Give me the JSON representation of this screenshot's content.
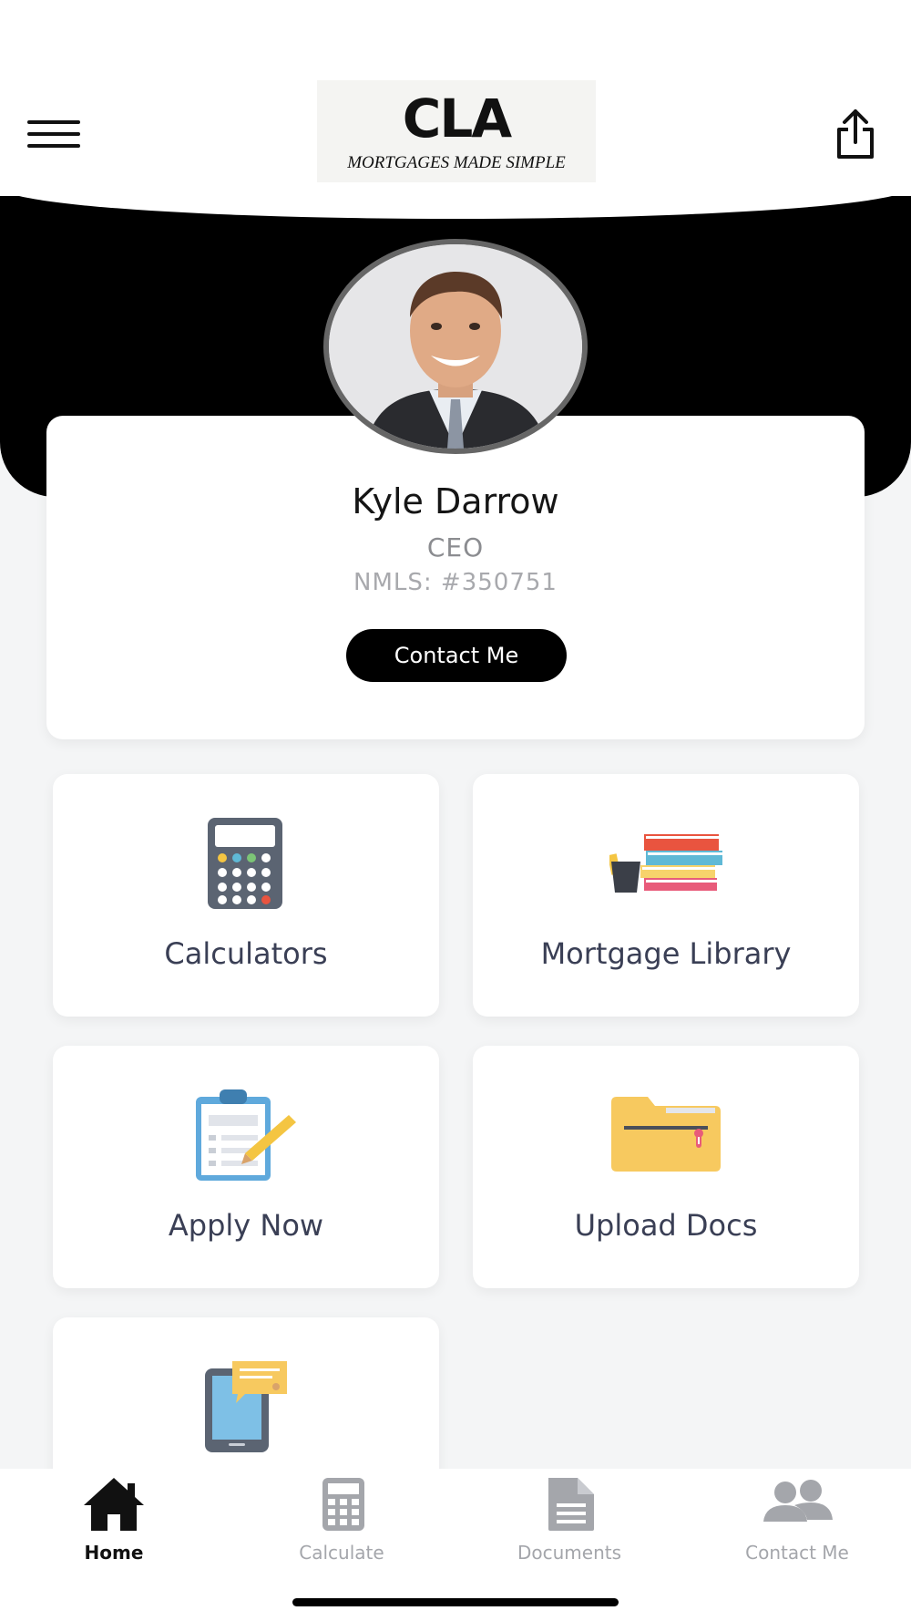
{
  "header": {
    "menu_icon": "hamburger-menu-icon",
    "logo_text": "CLA",
    "logo_tagline": "MORTGAGES MADE SIMPLE",
    "share_icon": "share-icon"
  },
  "profile": {
    "name": "Kyle Darrow",
    "title": "CEO",
    "nmls": "NMLS: #350751",
    "contact_button": "Contact Me"
  },
  "tiles": [
    {
      "label": "Calculators",
      "icon": "calculator-icon"
    },
    {
      "label": "Mortgage Library",
      "icon": "books-icon"
    },
    {
      "label": "Apply Now",
      "icon": "clipboard-icon"
    },
    {
      "label": "Upload Docs",
      "icon": "folder-icon"
    },
    {
      "label": "",
      "icon": "tablet-message-icon"
    }
  ],
  "bottom_nav": [
    {
      "label": "Home",
      "icon": "home-icon",
      "active": true
    },
    {
      "label": "Calculate",
      "icon": "calculator-icon",
      "active": false
    },
    {
      "label": "Documents",
      "icon": "document-icon",
      "active": false
    },
    {
      "label": "Contact Me",
      "icon": "people-icon",
      "active": false
    }
  ],
  "colors": {
    "hero_background": "#000000",
    "page_background": "#f4f5f6",
    "accent_yellow": "#f2df1d",
    "tile_text": "#3a3f55",
    "nav_inactive": "#a4a6ab"
  }
}
